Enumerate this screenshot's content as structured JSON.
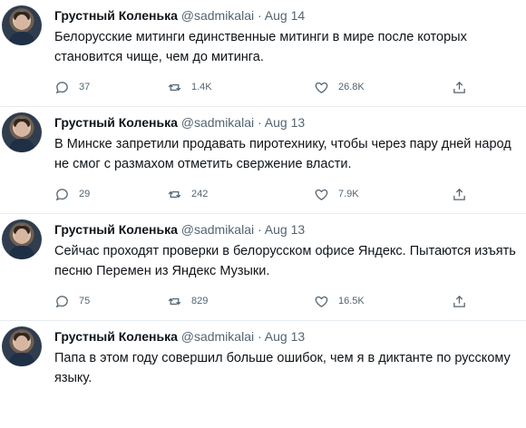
{
  "tweets": [
    {
      "name": "Грустный Коленька",
      "handle": "@sadmikalai",
      "separator": "·",
      "date": "Aug 14",
      "text": "Белорусские митинги единственные митинги в мире после которых становится чище, чем до митинга.",
      "replies": "37",
      "retweets": "1.4K",
      "likes": "26.8K"
    },
    {
      "name": "Грустный Коленька",
      "handle": "@sadmikalai",
      "separator": "·",
      "date": "Aug 13",
      "text": "В Минске запретили продавать пиротехнику, чтобы через пару дней народ не смог с размахом отметить свержение власти.",
      "replies": "29",
      "retweets": "242",
      "likes": "7.9K"
    },
    {
      "name": "Грустный Коленька",
      "handle": "@sadmikalai",
      "separator": "·",
      "date": "Aug 13",
      "text": "Сейчас проходят проверки в белорусском офисе Яндекс. Пытаются изъять песню Перемен из Яндекс Музыки.",
      "replies": "75",
      "retweets": "829",
      "likes": "16.5K"
    },
    {
      "name": "Грустный Коленька",
      "handle": "@sadmikalai",
      "separator": "·",
      "date": "Aug 13",
      "text": "Папа в этом году совершил больше ошибок, чем я в диктанте по русскому языку."
    }
  ],
  "icons": {
    "reply": "reply-icon",
    "retweet": "retweet-icon",
    "like": "heart-icon",
    "share": "share-icon"
  },
  "colors": {
    "text": "#0f1419",
    "secondary": "#536471",
    "border": "#e6ecf0"
  }
}
